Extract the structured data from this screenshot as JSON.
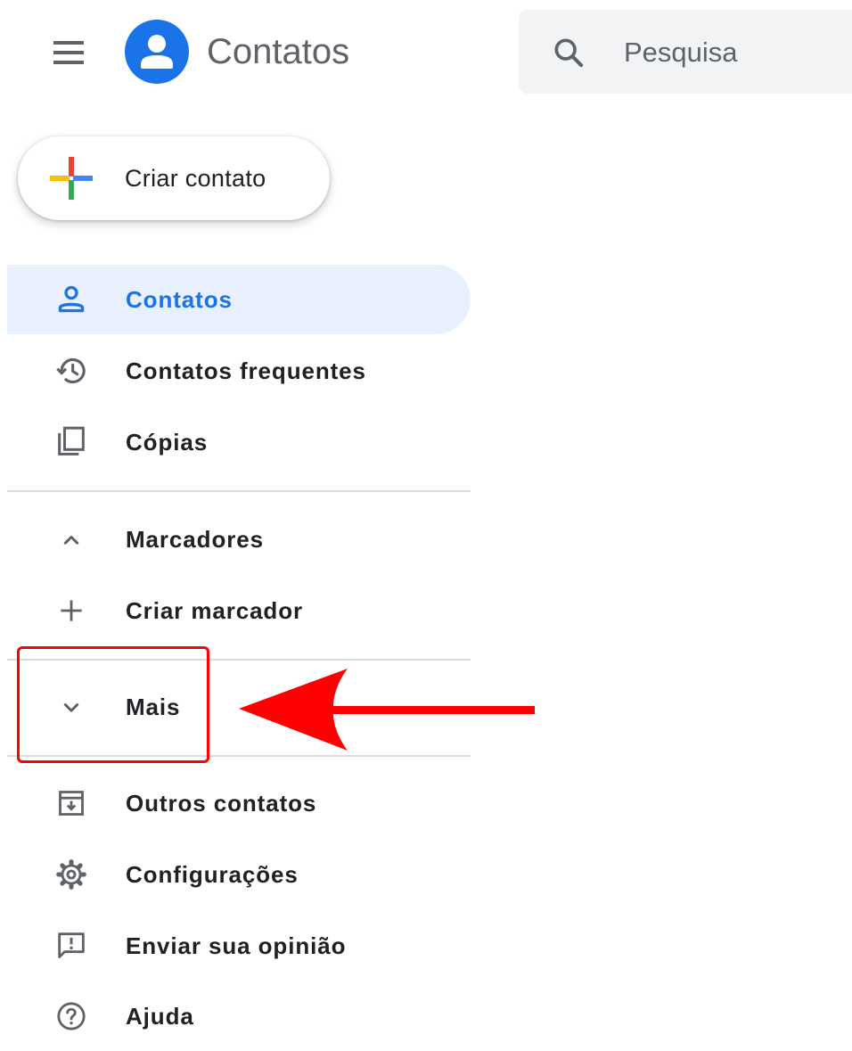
{
  "header": {
    "menu_icon": "hamburger-menu-icon",
    "logo_icon": "account-circle-icon",
    "app_title": "Contatos",
    "search": {
      "icon": "search-icon",
      "placeholder": "Pesquisa",
      "value": ""
    }
  },
  "create_button": {
    "icon": "colored-plus-icon",
    "label": "Criar contato"
  },
  "nav": {
    "items": [
      {
        "icon": "person-icon",
        "label": "Contatos",
        "active": true
      },
      {
        "icon": "history-icon",
        "label": "Contatos frequentes"
      },
      {
        "icon": "copy-icon",
        "label": "Cópias"
      },
      {
        "icon": "chevron-up-icon",
        "label": "Marcadores"
      },
      {
        "icon": "plus-icon",
        "label": "Criar marcador"
      },
      {
        "icon": "chevron-down-icon",
        "label": "Mais"
      },
      {
        "icon": "archive-icon",
        "label": "Outros contatos"
      },
      {
        "icon": "gear-icon",
        "label": "Configurações"
      },
      {
        "icon": "feedback-icon",
        "label": "Enviar sua opinião"
      },
      {
        "icon": "help-icon",
        "label": "Ajuda"
      }
    ]
  },
  "colors": {
    "accent": "#1a73e8",
    "active_bg": "#e8f0fe",
    "annotation": "#ff0000",
    "plus_red": "#ea4335",
    "plus_yellow": "#fbbc04",
    "plus_green": "#34a853",
    "plus_blue": "#4285f4"
  }
}
